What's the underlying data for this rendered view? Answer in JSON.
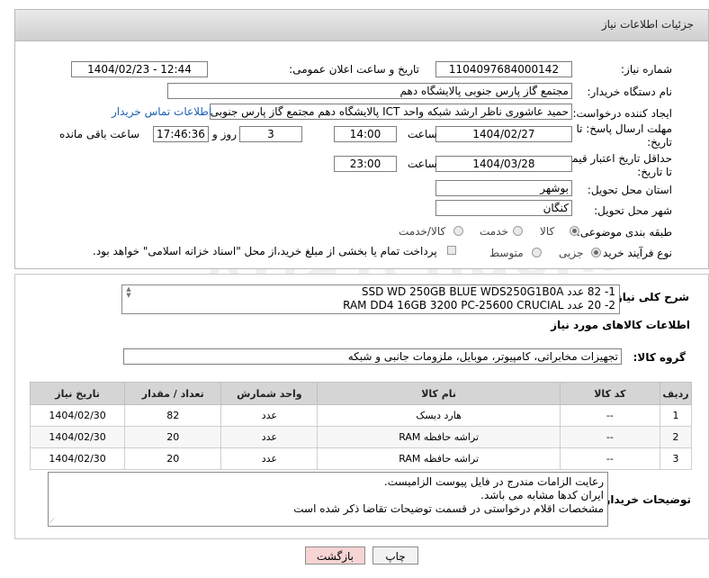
{
  "header": {
    "title": "جزئیات اطلاعات نیاز"
  },
  "form": {
    "need_number_label": "شماره نیاز:",
    "need_number": "1104097684000142",
    "announce_label": "تاریخ و ساعت اعلان عمومی:",
    "announce_value": "1404/02/23 - 12:44",
    "buyer_org_label": "نام دستگاه خریدار:",
    "buyer_org": "مجتمع گاز پارس جنوبی  پالایشگاه دهم",
    "creator_label": "ایجاد کننده درخواست:",
    "creator": "حمید عاشوری ناظر ارشد شبکه واحد ICT پالایشگاه دهم مجتمع گاز پارس جنوبی",
    "contact_link": "اطلاعات تماس خریدار",
    "deadline_label_1": "مهلت ارسال پاسخ: تا",
    "deadline_label_2": "تاریخ:",
    "deadline_date": "1404/02/27",
    "time_label": "ساعت",
    "deadline_time": "14:00",
    "deadline_days": "3",
    "days_label": "روز و",
    "deadline_remaining": "17:46:36",
    "remaining_label": "ساعت باقی مانده",
    "validity_label_1": "حداقل تاریخ اعتبار قیمت:",
    "validity_label_2": "تا تاریخ:",
    "validity_date": "1404/03/28",
    "validity_time_label": "ساعت",
    "validity_time": "23:00",
    "province_label": "استان محل تحویل:",
    "province": "بوشهر",
    "city_label": "شهر محل تحویل:",
    "city": "کنگان",
    "category_label": "طبقه بندی موضوعی:",
    "category_options": [
      "کالا",
      "خدمت",
      "کالا/خدمت"
    ],
    "process_label": "نوع فرآیند خرید :",
    "process_options": [
      "جزیی",
      "متوسط"
    ],
    "payment_note": "پرداخت تمام یا بخشی از مبلغ خرید،از محل \"اسناد خزانه اسلامی\" خواهد بود."
  },
  "description": {
    "label": "شرح کلی نیاز:",
    "lines": [
      "1- 82 عدد  SSD WD 250GB BLUE WDS250G1B0A",
      "2- 20 عدد RAM DD4 16GB 3200 PC-25600 CRUCIAL"
    ]
  },
  "goods_info": {
    "title": "اطلاعات کالاهای مورد نیاز"
  },
  "goods_group": {
    "label": "گروه کالا:",
    "value": "تجهیزات مخابراتی، کامپیوتر، موبایل، ملزومات جانبی و شبکه"
  },
  "table": {
    "headers": [
      "ردیف",
      "کد کالا",
      "نام کالا",
      "واحد شمارش",
      "تعداد / مقدار",
      "تاریخ نیاز"
    ],
    "rows": [
      [
        "1",
        "--",
        "هارد دیسک",
        "عدد",
        "82",
        "1404/02/30"
      ],
      [
        "2",
        "--",
        "تراشه حافظه RAM",
        "عدد",
        "20",
        "1404/02/30"
      ],
      [
        "3",
        "--",
        "تراشه حافظه RAM",
        "عدد",
        "20",
        "1404/02/30"
      ]
    ]
  },
  "buyer_notes": {
    "label": "توضیحات خریدار:",
    "lines": [
      "رعایت الزامات مندرج در فایل پیوست الزامیست.",
      "ایران کدها مشابه می باشد.",
      "مشخصات اقلام درخواستی در قسمت توضیحات تقاضا ذکر شده است"
    ]
  },
  "buttons": {
    "print": "چاپ",
    "back": "بازگشت"
  },
  "watermark": "AriaTender.neT",
  "colors": {
    "back_button": "#f7d4d4",
    "print_button": "#f2f2f2",
    "link": "#1a5fb4"
  }
}
